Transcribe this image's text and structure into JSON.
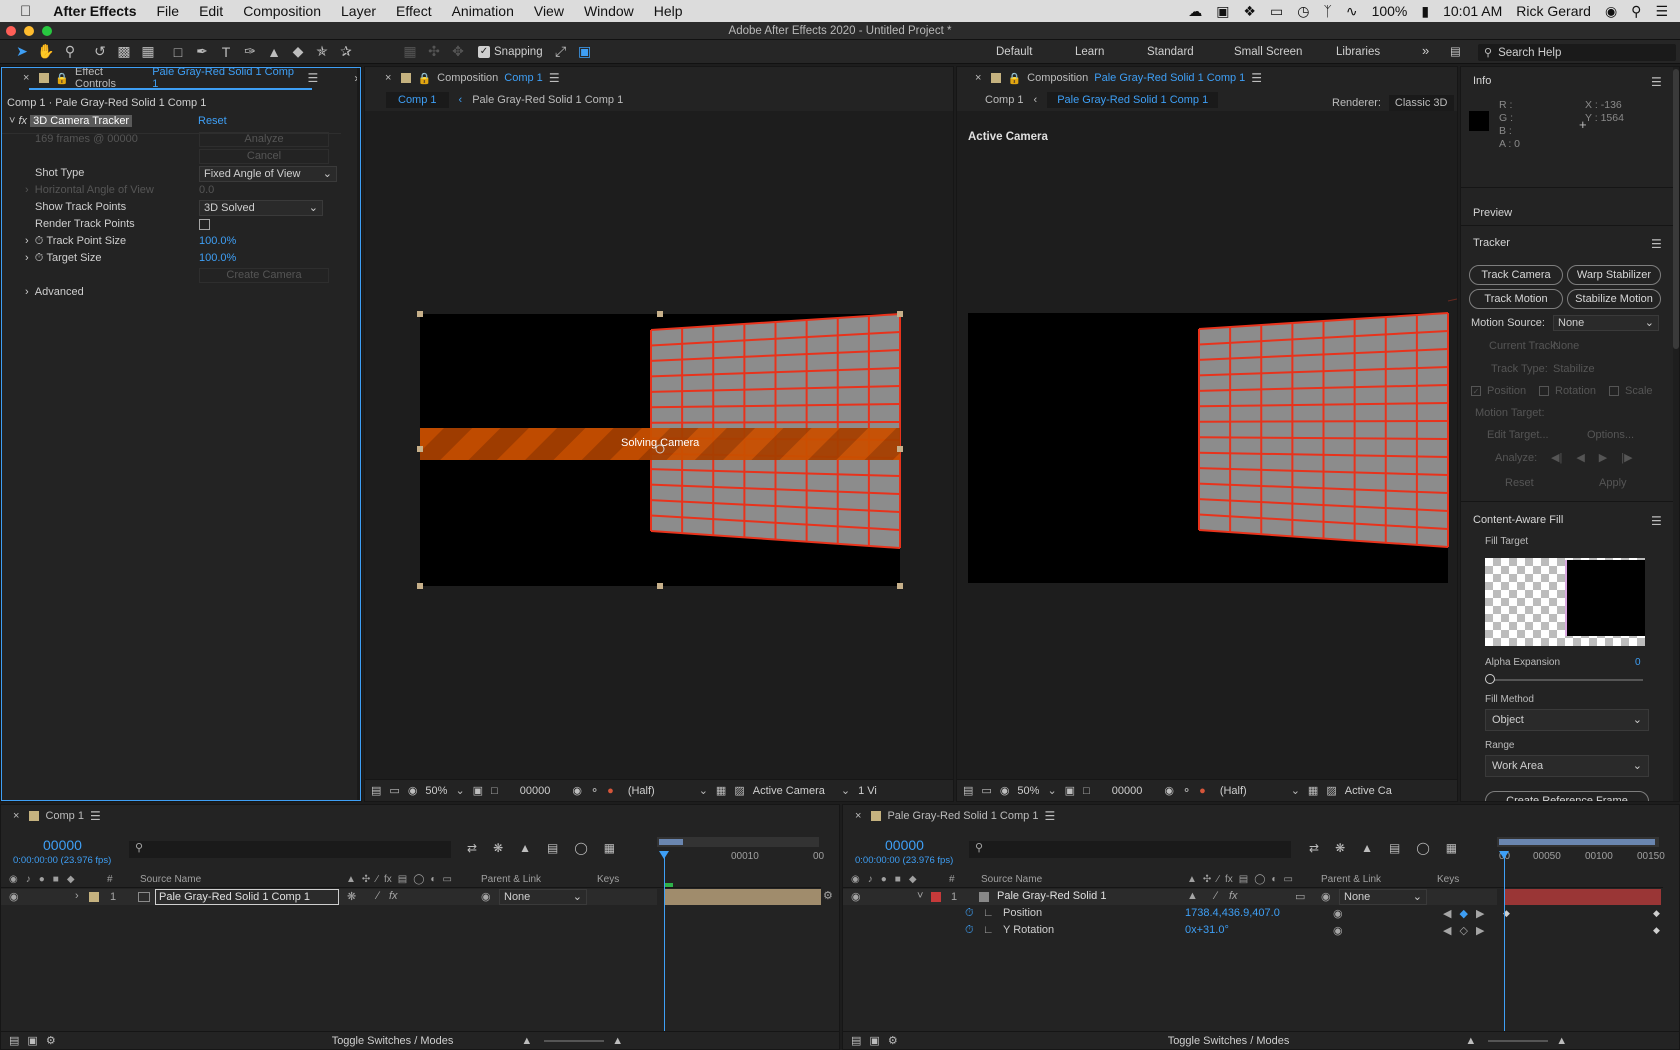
{
  "menubar": {
    "app": "After Effects",
    "items": [
      "File",
      "Edit",
      "Composition",
      "Layer",
      "Effect",
      "Animation",
      "View",
      "Window",
      "Help"
    ],
    "battery": "100%",
    "time": "10:01 AM",
    "user": "Rick Gerard"
  },
  "window": {
    "title": "Adobe After Effects 2020 - Untitled Project *"
  },
  "toolbar": {
    "snapping": "Snapping",
    "workspaces": [
      "Default",
      "Learn",
      "Standard",
      "Small Screen",
      "Libraries"
    ],
    "search_placeholder": "Search Help"
  },
  "effect_panel": {
    "tab_prefix": "Effect Controls",
    "tab_layer": "Pale Gray-Red Solid 1 Comp 1",
    "path": "Comp 1 · Pale Gray-Red Solid 1 Comp 1",
    "effect_name": "3D Camera Tracker",
    "reset": "Reset",
    "frames": "169 frames @ 00000",
    "analyze": "Analyze",
    "cancel": "Cancel",
    "shot_type_label": "Shot Type",
    "shot_type": "Fixed Angle of View",
    "hav_label": "Horizontal Angle of View",
    "hav_value": "0.0",
    "show_tp_label": "Show Track Points",
    "show_tp": "3D Solved",
    "render_tp_label": "Render Track Points",
    "tps_label": "Track Point Size",
    "tps_value": "100.0%",
    "ts_label": "Target Size",
    "ts_value": "100.0%",
    "create_camera": "Create Camera",
    "advanced": "Advanced"
  },
  "comp1": {
    "tab_prefix": "Composition",
    "tab_name": "Comp 1",
    "crumb_active": "Comp 1",
    "crumb_other": "Pale Gray-Red Solid 1 Comp 1",
    "status": "Solving Camera",
    "zoom": "50%",
    "timecode": "00000",
    "res": "(Half)",
    "camera": "Active Camera",
    "views": "1 Vi"
  },
  "comp2": {
    "tab_prefix": "Composition",
    "tab_name": "Pale Gray-Red Solid 1 Comp 1",
    "crumb_other": "Comp 1",
    "crumb_active": "Pale Gray-Red Solid 1 Comp 1",
    "renderer_label": "Renderer:",
    "renderer": "Classic 3D",
    "label": "Active Camera",
    "zoom": "50%",
    "timecode": "00000",
    "res": "(Half)",
    "camera": "Active Ca"
  },
  "info": {
    "title": "Info",
    "r": "R :",
    "g": "G :",
    "b": "B :",
    "a": "A :  0",
    "x": "X : -136",
    "y": "Y : 1564",
    "preview": "Preview"
  },
  "tracker": {
    "title": "Tracker",
    "track_camera": "Track Camera",
    "warp": "Warp Stabilizer",
    "track_motion": "Track Motion",
    "stabilize": "Stabilize Motion",
    "motion_source_label": "Motion Source:",
    "motion_source": "None",
    "current_track_label": "Current Track:",
    "current_track": "None",
    "track_type_label": "Track Type:",
    "track_type": "Stabilize",
    "position": "Position",
    "rotation": "Rotation",
    "scale": "Scale",
    "motion_target": "Motion Target:",
    "edit_target": "Edit Target...",
    "options": "Options...",
    "analyze": "Analyze:",
    "reset": "Reset",
    "apply": "Apply"
  },
  "caf": {
    "title": "Content-Aware Fill",
    "fill_target": "Fill Target",
    "alpha_label": "Alpha Expansion",
    "alpha_value": "0",
    "fill_method_label": "Fill Method",
    "fill_method": "Object",
    "range_label": "Range",
    "range": "Work Area",
    "create_ref": "Create Reference Frame"
  },
  "tl1": {
    "tab": "Comp 1",
    "timecode": "00000",
    "fps": "0:00:00:00 (23.976 fps)",
    "col_num": "#",
    "col_source": "Source Name",
    "col_parent": "Parent & Link",
    "col_keys": "Keys",
    "tick1": "00010",
    "tick2": "00",
    "layer_num": "1",
    "layer_name": "Pale Gray-Red Solid 1 Comp 1",
    "parent": "None",
    "toggle": "Toggle Switches / Modes"
  },
  "tl2": {
    "tab": "Pale Gray-Red Solid 1 Comp 1",
    "timecode": "00000",
    "fps": "0:00:00:00 (23.976 fps)",
    "col_num": "#",
    "col_source": "Source Name",
    "col_parent": "Parent & Link",
    "col_keys": "Keys",
    "ticks": [
      "00050",
      "00100",
      "00150"
    ],
    "tick0": "00",
    "layer_num": "1",
    "layer_name": "Pale Gray-Red Solid 1",
    "parent": "None",
    "prop1": "Position",
    "prop1_value": "1738.4,436.9,407.0",
    "prop2": "Y Rotation",
    "prop2_value": "0x+31.0°",
    "toggle": "Toggle Switches / Modes"
  },
  "colors": {
    "accent": "#3e9ff5",
    "grid_red": "#e8331c",
    "orange": "#e05a00"
  }
}
